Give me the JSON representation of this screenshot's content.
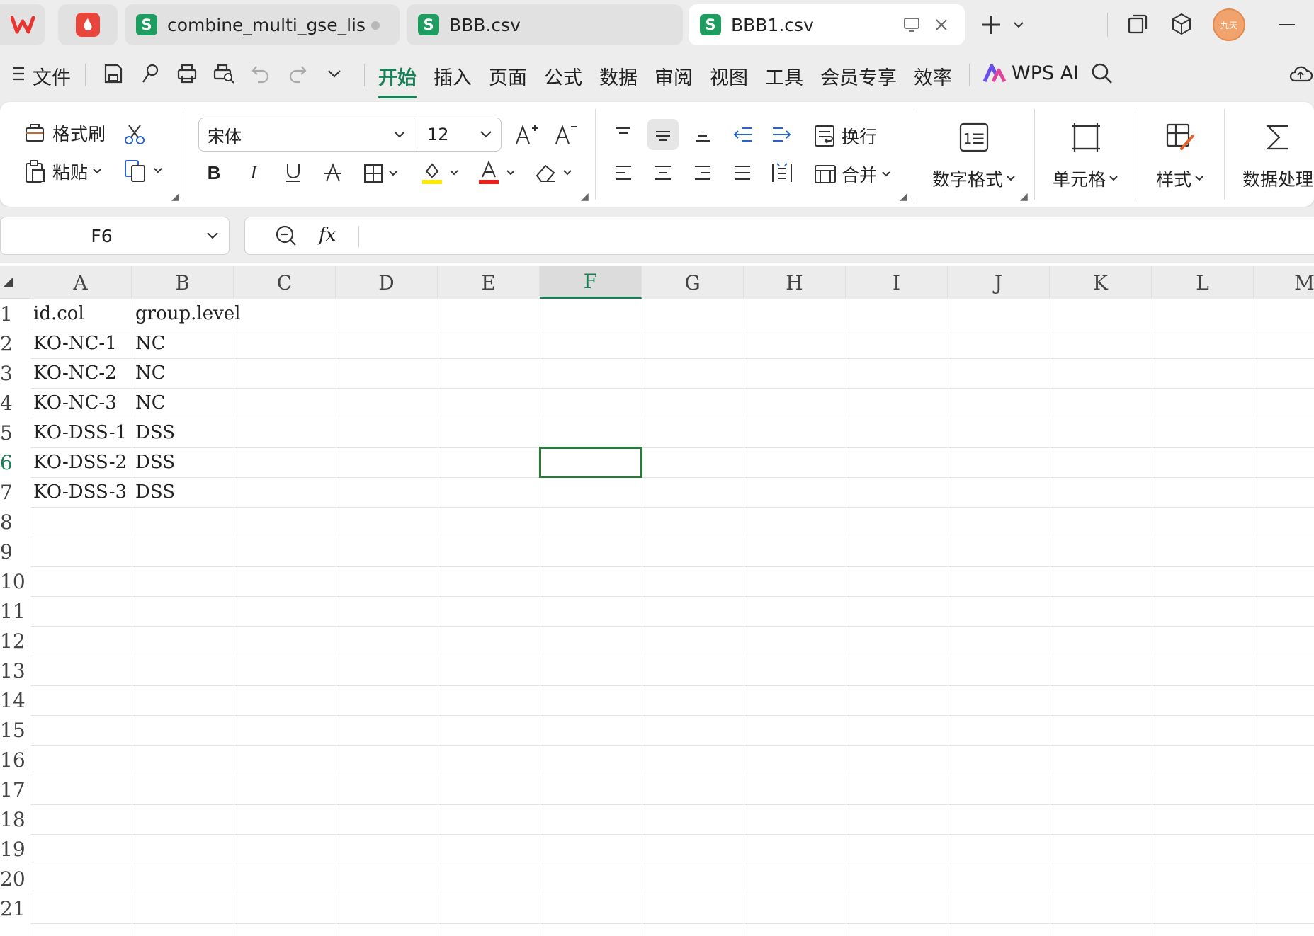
{
  "titlebar": {
    "tabs": [
      {
        "label": "combine_multi_gse_list_i",
        "icon": "S",
        "modified": true
      },
      {
        "label": "BBB.csv",
        "icon": "S"
      },
      {
        "label": "BBB1.csv",
        "icon": "S",
        "active": true
      }
    ],
    "avatar_text": "九天"
  },
  "menubar": {
    "file_label": "文件",
    "tabs": [
      "开始",
      "插入",
      "页面",
      "公式",
      "数据",
      "审阅",
      "视图",
      "工具",
      "会员专享",
      "效率"
    ],
    "active_tab": "开始",
    "ai_label": "WPS AI"
  },
  "ribbon": {
    "format_painter": "格式刷",
    "paste": "粘贴",
    "font_name": "宋体",
    "font_size": "12",
    "wrap": "换行",
    "merge": "合并",
    "number_format": "数字格式",
    "cell": "单元格",
    "style": "样式",
    "data_processing": "数据处理"
  },
  "formula_bar": {
    "name_box": "F6",
    "fx": "fx",
    "formula": ""
  },
  "sheet": {
    "columns": [
      "A",
      "B",
      "C",
      "D",
      "E",
      "F",
      "G",
      "H",
      "I",
      "J",
      "K",
      "L",
      "M"
    ],
    "rows": [
      "1",
      "2",
      "3",
      "4",
      "5",
      "6",
      "7",
      "8",
      "9",
      "10",
      "11",
      "12",
      "13",
      "14",
      "15",
      "16",
      "17",
      "18",
      "19",
      "20",
      "21"
    ],
    "selected_cell": "F6",
    "cells": [
      [
        "id.col",
        "group.level"
      ],
      [
        "KO-NC-1",
        "NC"
      ],
      [
        "KO-NC-2",
        "NC"
      ],
      [
        "KO-NC-3",
        "NC"
      ],
      [
        "KO-DSS-1",
        "DSS"
      ],
      [
        "KO-DSS-2",
        "DSS"
      ],
      [
        "KO-DSS-3",
        "DSS"
      ]
    ]
  },
  "colors": {
    "accent": "#1a7f56",
    "sheet_icon": "#1f9d61",
    "selection_border": "#2a7b3a"
  }
}
